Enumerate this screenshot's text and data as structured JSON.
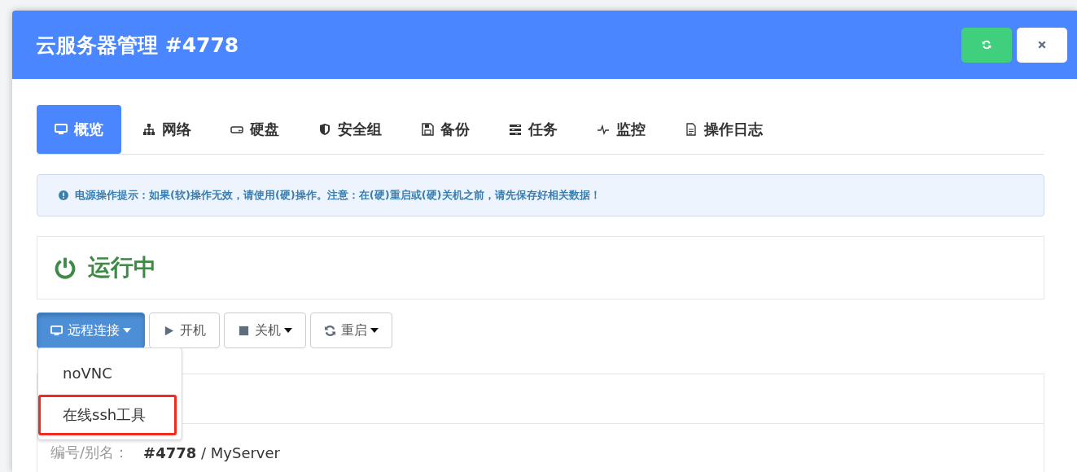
{
  "window": {
    "title": "云服务器管理 #4778"
  },
  "header_buttons": [
    {
      "kind": "refresh"
    },
    {
      "kind": "close"
    }
  ],
  "tabs": [
    {
      "label": "概览",
      "kind": "monitor",
      "selected": true
    },
    {
      "label": "网络",
      "kind": "sitemap",
      "selected": false
    },
    {
      "label": "硬盘",
      "kind": "drive",
      "selected": false
    },
    {
      "label": "安全组",
      "kind": "shield",
      "selected": false
    },
    {
      "label": "备份",
      "kind": "save",
      "selected": false
    },
    {
      "label": "任务",
      "kind": "tasks",
      "selected": false
    },
    {
      "label": "监控",
      "kind": "pulse",
      "selected": false
    },
    {
      "label": "操作日志",
      "kind": "file",
      "selected": false
    }
  ],
  "alert": {
    "text": "电源操作提示：如果(软)操作无效，请使用(硬)操作。注意：在(硬)重启或(硬)关机之前，请先保存好相关数据！"
  },
  "status": {
    "text": "运行中"
  },
  "actions": [
    {
      "label": "远程连接",
      "kind": "remote",
      "caret": true,
      "expanded": true
    },
    {
      "label": "开机",
      "kind": "start",
      "caret": false,
      "expanded": false
    },
    {
      "label": "关机",
      "kind": "shutdown",
      "caret": true,
      "expanded": false
    },
    {
      "label": "重启",
      "kind": "reboot",
      "caret": true,
      "expanded": false
    }
  ],
  "dropdown": [
    {
      "label": "noVNC",
      "highlighted": false
    },
    {
      "label": "在线ssh工具",
      "highlighted": true
    }
  ],
  "info_rows": [
    {
      "label": "编号/别名：",
      "value": "**#4778** / MyServer"
    }
  ]
}
